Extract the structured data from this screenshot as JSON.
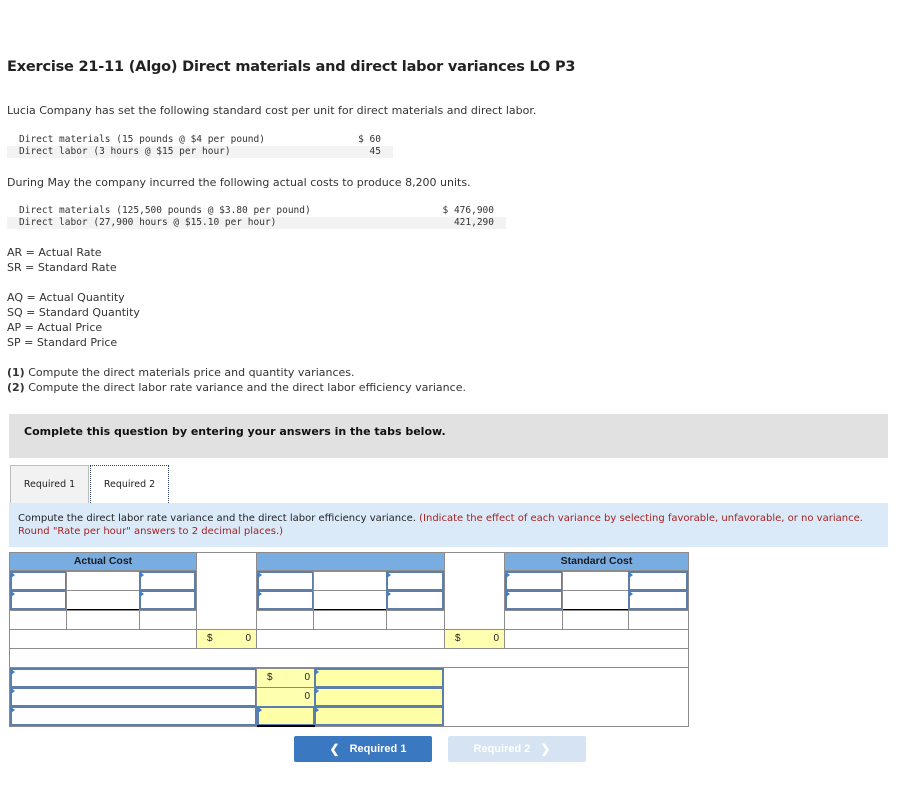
{
  "title": "Exercise 21-11 (Algo) Direct materials and direct labor variances LO P3",
  "intro": "Lucia Company has set the following standard cost per unit for direct materials and direct labor.",
  "standard_costs": [
    {
      "label": "Direct materials (15 pounds @ $4 per pound)",
      "amount": "$ 60"
    },
    {
      "label": "Direct labor (3 hours @ $15 per hour)",
      "amount": "45"
    }
  ],
  "actual_intro": "During May the company incurred the following actual costs to produce 8,200 units.",
  "actual_costs": [
    {
      "label": "Direct materials (125,500 pounds @ $3.80 per pound)",
      "amount": "$ 476,900"
    },
    {
      "label": "Direct labor (27,900 hours @ $15.10 per hour)",
      "amount": "421,290"
    }
  ],
  "definitions_rate": [
    "AR = Actual Rate",
    "SR = Standard Rate"
  ],
  "definitions_qty": [
    "AQ = Actual Quantity",
    "SQ = Standard Quantity",
    "AP = Actual Price",
    "SP = Standard Price"
  ],
  "tasks": [
    {
      "num": "(1)",
      "text": " Compute the direct materials price and quantity variances."
    },
    {
      "num": "(2)",
      "text": " Compute the direct labor rate variance and the direct labor efficiency variance."
    }
  ],
  "banner": "Complete this question by entering your answers in the tabs below.",
  "tabs": [
    {
      "label": "Required 1",
      "active": false
    },
    {
      "label": "Required 2",
      "active": true
    }
  ],
  "instruction": {
    "main": "Compute the direct labor rate variance and the direct labor efficiency variance. ",
    "note": "(Indicate the effect of each variance by selecting favorable, unfavorable, or no variance. Round \"Rate per hour\" answers to 2 decimal places.)"
  },
  "worksheet": {
    "actual_header": "Actual Cost",
    "middle_header": "",
    "standard_header": "Standard Cost",
    "total_1": {
      "currency": "$",
      "value": "0"
    },
    "total_2": {
      "currency": "$",
      "value": "0"
    },
    "variance_1": {
      "currency": "$",
      "value": "0"
    },
    "variance_2": {
      "currency": "",
      "value": "0"
    }
  },
  "nav": {
    "prev_label": "Required 1",
    "next_label": "Required 2"
  }
}
